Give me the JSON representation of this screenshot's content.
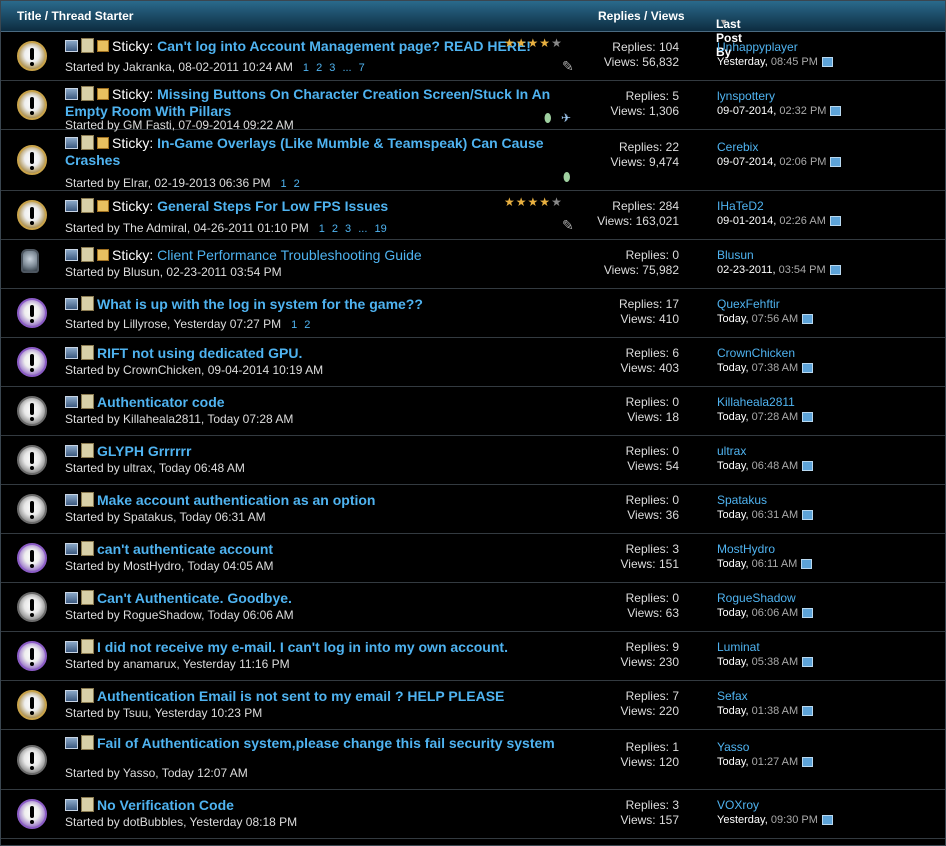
{
  "header": {
    "title_col": "Title / Thread Starter",
    "replies_col": "Replies / Views",
    "last_col": "Last Post By"
  },
  "threads": [
    {
      "prefix": "Sticky:",
      "title": "Can't log into Account Management page? READ HERE!",
      "starter": "Started by Jakranka, 08-02-2011 10:24 AM",
      "pages": "1 2 3 ... 7",
      "replies": "Replies: 104",
      "views": "Views: 56,832",
      "last_user": "Unhappyplayer",
      "last_date": "Yesterday,",
      "last_time": "08:45 PM",
      "rating": 4
    },
    {
      "prefix": "Sticky:",
      "title": "Missing Buttons On Character Creation Screen/Stuck In An Empty Room With Pillars",
      "starter": "Started by GM Fasti, 07-09-2014 09:22 AM",
      "pages": "",
      "replies": "Replies: 5",
      "views": "Views: 1,306",
      "last_user": "lynspottery",
      "last_date": "09-07-2014,",
      "last_time": "02:32 PM"
    },
    {
      "prefix": "Sticky:",
      "title": "In-Game Overlays (Like Mumble & Teamspeak) Can Cause Crashes",
      "starter": "Started by Elrar, 02-19-2013 06:36 PM",
      "pages": "1 2",
      "replies": "Replies: 22",
      "views": "Views: 9,474",
      "last_user": "Cerebix",
      "last_date": "09-07-2014,",
      "last_time": "02:06 PM"
    },
    {
      "prefix": "Sticky:",
      "title": "General Steps For Low FPS Issues",
      "starter": "Started by The Admiral, 04-26-2011 01:10 PM",
      "pages": "1 2 3 ... 19",
      "replies": "Replies: 284",
      "views": "Views: 163,021",
      "last_user": "IHaTeD2",
      "last_date": "09-01-2014,",
      "last_time": "02:26 AM",
      "rating": 4
    },
    {
      "prefix": "Sticky:",
      "title": "Client Performance Troubleshooting Guide",
      "starter": "Started by Blusun, 02-23-2011 03:54 PM",
      "pages": "",
      "replies": "Replies: 0",
      "views": "Views: 75,982",
      "last_user": "Blusun",
      "last_date": "02-23-2011,",
      "last_time": "03:54 PM"
    },
    {
      "prefix": "",
      "title": "What is up with the log in system for the game??",
      "starter": "Started by Lillyrose, Yesterday 07:27 PM",
      "pages": "1 2",
      "replies": "Replies: 17",
      "views": "Views: 410",
      "last_user": "QuexFehftir",
      "last_date": "Today,",
      "last_time": "07:56 AM"
    },
    {
      "prefix": "",
      "title": "RIFT not using dedicated GPU.",
      "starter": "Started by CrownChicken, 09-04-2014 10:19 AM",
      "pages": "",
      "replies": "Replies: 6",
      "views": "Views: 403",
      "last_user": "CrownChicken",
      "last_date": "Today,",
      "last_time": "07:38 AM"
    },
    {
      "prefix": "",
      "title": "Authenticator code",
      "starter": "Started by Killaheala2811, Today 07:28 AM",
      "pages": "",
      "replies": "Replies: 0",
      "views": "Views: 18",
      "last_user": "Killaheala2811",
      "last_date": "Today,",
      "last_time": "07:28 AM"
    },
    {
      "prefix": "",
      "title": "GLYPH Grrrrrr",
      "starter": "Started by ultrax, Today 06:48 AM",
      "pages": "",
      "replies": "Replies: 0",
      "views": "Views: 54",
      "last_user": "ultrax",
      "last_date": "Today,",
      "last_time": "06:48 AM"
    },
    {
      "prefix": "",
      "title": "Make account authentication as an option",
      "starter": "Started by Spatakus, Today 06:31 AM",
      "pages": "",
      "replies": "Replies: 0",
      "views": "Views: 36",
      "last_user": "Spatakus",
      "last_date": "Today,",
      "last_time": "06:31 AM"
    },
    {
      "prefix": "",
      "title": "can't authenticate account",
      "starter": "Started by MostHydro, Today 04:05 AM",
      "pages": "",
      "replies": "Replies: 3",
      "views": "Views: 151",
      "last_user": "MostHydro",
      "last_date": "Today,",
      "last_time": "06:11 AM"
    },
    {
      "prefix": "",
      "title": "Can't Authenticate. Goodbye.",
      "starter": "Started by RogueShadow, Today 06:06 AM",
      "pages": "",
      "replies": "Replies: 0",
      "views": "Views: 63",
      "last_user": "RogueShadow",
      "last_date": "Today,",
      "last_time": "06:06 AM"
    },
    {
      "prefix": "",
      "title": "I did not receive my e-mail. I can't log in into my own account.",
      "starter": "Started by anamarux, Yesterday 11:16 PM",
      "pages": "",
      "replies": "Replies: 9",
      "views": "Views: 230",
      "last_user": "Luminat",
      "last_date": "Today,",
      "last_time": "05:38 AM"
    },
    {
      "prefix": "",
      "title": "Authentication Email is not sent to my email ? HELP PLEASE",
      "starter": "Started by Tsuu, Yesterday 10:23 PM",
      "pages": "",
      "replies": "Replies: 7",
      "views": "Views: 220",
      "last_user": "Sefax",
      "last_date": "Today,",
      "last_time": "01:38 AM"
    },
    {
      "prefix": "",
      "title": "Fail of Authentication system,please change this fail security system",
      "starter": "Started by Yasso, Today 12:07 AM",
      "pages": "",
      "replies": "Replies: 1",
      "views": "Views: 120",
      "last_user": "Yasso",
      "last_date": "Today,",
      "last_time": "01:27 AM"
    },
    {
      "prefix": "",
      "title": "No Verification Code",
      "starter": "Started by dotBubbles, Yesterday 08:18 PM",
      "pages": "",
      "replies": "Replies: 3",
      "views": "Views: 157",
      "last_user": "VOXroy",
      "last_date": "Yesterday,",
      "last_time": "09:30 PM"
    }
  ]
}
